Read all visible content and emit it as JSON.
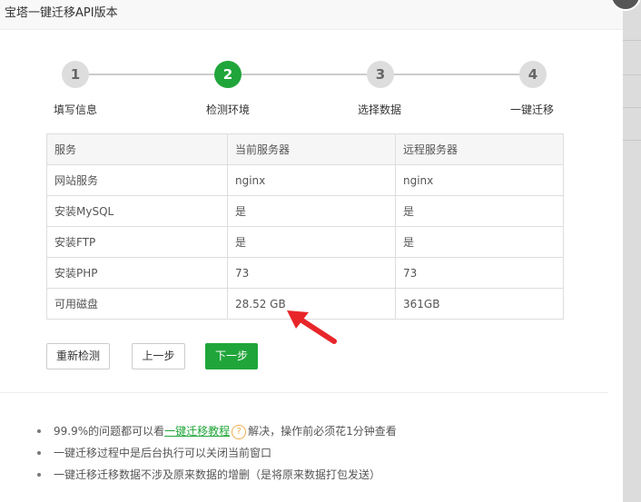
{
  "dialog": {
    "title": "宝塔一键迁移API版本"
  },
  "steps": [
    {
      "number": "1",
      "label": "填写信息",
      "active": false
    },
    {
      "number": "2",
      "label": "检测环境",
      "active": true
    },
    {
      "number": "3",
      "label": "选择数据",
      "active": false
    },
    {
      "number": "4",
      "label": "一键迁移",
      "active": false
    }
  ],
  "table": {
    "headers": [
      "服务",
      "当前服务器",
      "远程服务器"
    ],
    "rows": [
      [
        "网站服务",
        "nginx",
        "nginx"
      ],
      [
        "安装MySQL",
        "是",
        "是"
      ],
      [
        "安装FTP",
        "是",
        "是"
      ],
      [
        "安装PHP",
        "73",
        "73"
      ],
      [
        "可用磁盘",
        "28.52 GB",
        "361GB"
      ]
    ]
  },
  "buttons": {
    "recheck": "重新检测",
    "prev": "上一步",
    "next": "下一步"
  },
  "notes": {
    "n1_prefix": "99.9%的问题都可以看",
    "n1_link": "一键迁移教程",
    "n1_help": "?",
    "n1_suffix": "解决，操作前必须花1分钟查看",
    "n2": "一键迁移过程中是后台执行可以关闭当前窗口",
    "n3": "一键迁移迁移数据不涉及原来数据的增删（是将原来数据打包发送）"
  },
  "colors": {
    "primary": "#20a53a",
    "arrow": "#e8262a"
  }
}
